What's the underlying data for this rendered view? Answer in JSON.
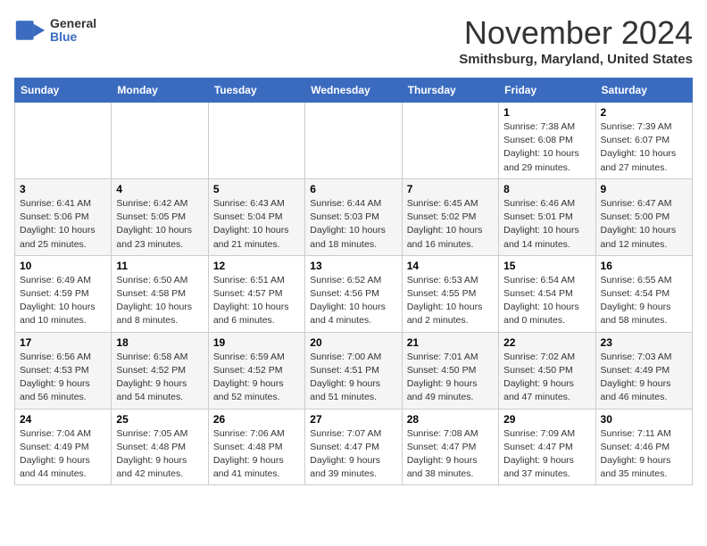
{
  "logo": {
    "general": "General",
    "blue": "Blue"
  },
  "title": "November 2024",
  "location": "Smithsburg, Maryland, United States",
  "days_of_week": [
    "Sunday",
    "Monday",
    "Tuesday",
    "Wednesday",
    "Thursday",
    "Friday",
    "Saturday"
  ],
  "weeks": [
    [
      {
        "day": "",
        "info": ""
      },
      {
        "day": "",
        "info": ""
      },
      {
        "day": "",
        "info": ""
      },
      {
        "day": "",
        "info": ""
      },
      {
        "day": "",
        "info": ""
      },
      {
        "day": "1",
        "info": "Sunrise: 7:38 AM\nSunset: 6:08 PM\nDaylight: 10 hours and 29 minutes."
      },
      {
        "day": "2",
        "info": "Sunrise: 7:39 AM\nSunset: 6:07 PM\nDaylight: 10 hours and 27 minutes."
      }
    ],
    [
      {
        "day": "3",
        "info": "Sunrise: 6:41 AM\nSunset: 5:06 PM\nDaylight: 10 hours and 25 minutes."
      },
      {
        "day": "4",
        "info": "Sunrise: 6:42 AM\nSunset: 5:05 PM\nDaylight: 10 hours and 23 minutes."
      },
      {
        "day": "5",
        "info": "Sunrise: 6:43 AM\nSunset: 5:04 PM\nDaylight: 10 hours and 21 minutes."
      },
      {
        "day": "6",
        "info": "Sunrise: 6:44 AM\nSunset: 5:03 PM\nDaylight: 10 hours and 18 minutes."
      },
      {
        "day": "7",
        "info": "Sunrise: 6:45 AM\nSunset: 5:02 PM\nDaylight: 10 hours and 16 minutes."
      },
      {
        "day": "8",
        "info": "Sunrise: 6:46 AM\nSunset: 5:01 PM\nDaylight: 10 hours and 14 minutes."
      },
      {
        "day": "9",
        "info": "Sunrise: 6:47 AM\nSunset: 5:00 PM\nDaylight: 10 hours and 12 minutes."
      }
    ],
    [
      {
        "day": "10",
        "info": "Sunrise: 6:49 AM\nSunset: 4:59 PM\nDaylight: 10 hours and 10 minutes."
      },
      {
        "day": "11",
        "info": "Sunrise: 6:50 AM\nSunset: 4:58 PM\nDaylight: 10 hours and 8 minutes."
      },
      {
        "day": "12",
        "info": "Sunrise: 6:51 AM\nSunset: 4:57 PM\nDaylight: 10 hours and 6 minutes."
      },
      {
        "day": "13",
        "info": "Sunrise: 6:52 AM\nSunset: 4:56 PM\nDaylight: 10 hours and 4 minutes."
      },
      {
        "day": "14",
        "info": "Sunrise: 6:53 AM\nSunset: 4:55 PM\nDaylight: 10 hours and 2 minutes."
      },
      {
        "day": "15",
        "info": "Sunrise: 6:54 AM\nSunset: 4:54 PM\nDaylight: 10 hours and 0 minutes."
      },
      {
        "day": "16",
        "info": "Sunrise: 6:55 AM\nSunset: 4:54 PM\nDaylight: 9 hours and 58 minutes."
      }
    ],
    [
      {
        "day": "17",
        "info": "Sunrise: 6:56 AM\nSunset: 4:53 PM\nDaylight: 9 hours and 56 minutes."
      },
      {
        "day": "18",
        "info": "Sunrise: 6:58 AM\nSunset: 4:52 PM\nDaylight: 9 hours and 54 minutes."
      },
      {
        "day": "19",
        "info": "Sunrise: 6:59 AM\nSunset: 4:52 PM\nDaylight: 9 hours and 52 minutes."
      },
      {
        "day": "20",
        "info": "Sunrise: 7:00 AM\nSunset: 4:51 PM\nDaylight: 9 hours and 51 minutes."
      },
      {
        "day": "21",
        "info": "Sunrise: 7:01 AM\nSunset: 4:50 PM\nDaylight: 9 hours and 49 minutes."
      },
      {
        "day": "22",
        "info": "Sunrise: 7:02 AM\nSunset: 4:50 PM\nDaylight: 9 hours and 47 minutes."
      },
      {
        "day": "23",
        "info": "Sunrise: 7:03 AM\nSunset: 4:49 PM\nDaylight: 9 hours and 46 minutes."
      }
    ],
    [
      {
        "day": "24",
        "info": "Sunrise: 7:04 AM\nSunset: 4:49 PM\nDaylight: 9 hours and 44 minutes."
      },
      {
        "day": "25",
        "info": "Sunrise: 7:05 AM\nSunset: 4:48 PM\nDaylight: 9 hours and 42 minutes."
      },
      {
        "day": "26",
        "info": "Sunrise: 7:06 AM\nSunset: 4:48 PM\nDaylight: 9 hours and 41 minutes."
      },
      {
        "day": "27",
        "info": "Sunrise: 7:07 AM\nSunset: 4:47 PM\nDaylight: 9 hours and 39 minutes."
      },
      {
        "day": "28",
        "info": "Sunrise: 7:08 AM\nSunset: 4:47 PM\nDaylight: 9 hours and 38 minutes."
      },
      {
        "day": "29",
        "info": "Sunrise: 7:09 AM\nSunset: 4:47 PM\nDaylight: 9 hours and 37 minutes."
      },
      {
        "day": "30",
        "info": "Sunrise: 7:11 AM\nSunset: 4:46 PM\nDaylight: 9 hours and 35 minutes."
      }
    ]
  ]
}
